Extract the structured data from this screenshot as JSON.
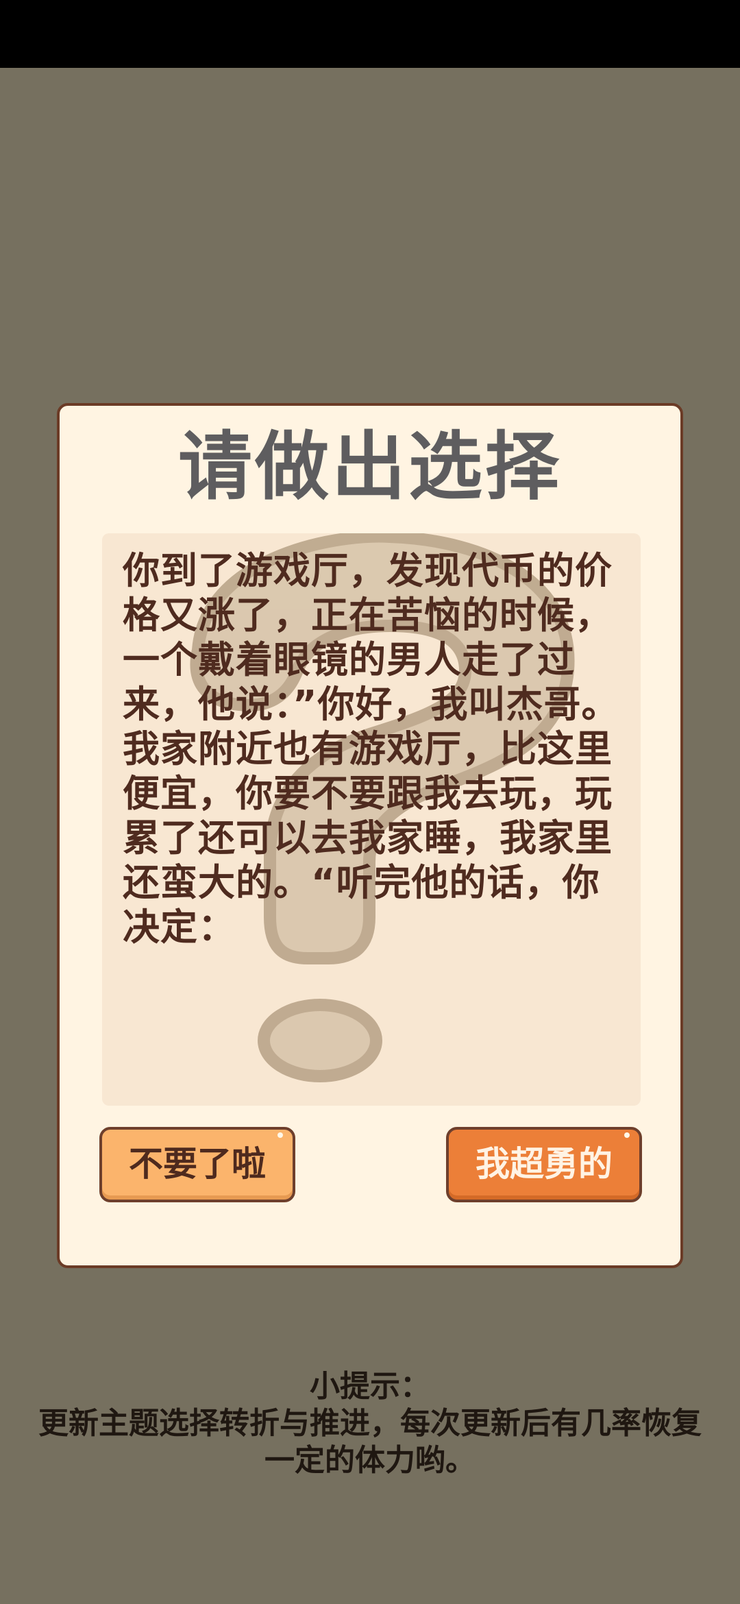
{
  "dialog": {
    "title": "请做出选择",
    "story": "你到了游戏厅，发现代币的价\n格又涨了，正在苦恼的时候，\n一个戴着眼镜的男人走了过\n来，他说：”你好，我叫杰哥。\n我家附近也有游戏厅，比这里\n便宜，你要不要跟我去玩，玩\n累了还可以去我家睡，我家里\n还蛮大的。“听完他的话，你\n决定：",
    "choices": [
      {
        "label": "不要了啦"
      },
      {
        "label": "我超勇的"
      }
    ],
    "background_icon": "question-mark-icon"
  },
  "tip": {
    "label": "小提示：",
    "text": "更新主题选择转折与推进，每次更新后有几率恢复\n一定的体力哟。"
  },
  "colors": {
    "background": "#76705f",
    "dialog_bg": "#fff4e2",
    "dialog_border": "#6b3b26",
    "panel_bg": "#f8e7d2",
    "text": "#4f2b1f",
    "title": "#5e5d5f",
    "button_left": "#fbb46c",
    "button_right": "#ec7f38"
  }
}
